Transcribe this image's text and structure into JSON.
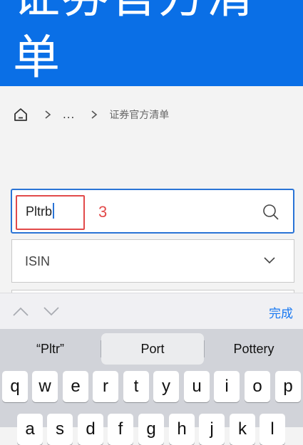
{
  "header": {
    "title": "证券官方清单",
    "visible_title": "单",
    "background": "#0a6fe6"
  },
  "breadcrumb": {
    "home_icon": "home-icon",
    "ellipsis": "...",
    "current": "证券官方清单"
  },
  "search": {
    "value": "Pltrb",
    "icon": "search-icon",
    "border_color": "#2a74d6"
  },
  "annotation": {
    "label": "3",
    "color": "#e24a4a"
  },
  "select": {
    "value": "ISIN",
    "icon": "chevron-down-icon"
  },
  "accessory": {
    "prev_icon": "chevron-up-icon",
    "next_icon": "chevron-down-icon",
    "done_label": "完成",
    "accent": "#1778f2"
  },
  "keyboard": {
    "suggestions": [
      "“Pltr”",
      "Port",
      "Pottery"
    ],
    "selected_suggestion": 1,
    "row1": [
      "q",
      "w",
      "e",
      "r",
      "t",
      "y",
      "u",
      "i",
      "o",
      "p"
    ],
    "row2": [
      "a",
      "s",
      "d",
      "f",
      "g",
      "h",
      "j",
      "k",
      "l"
    ]
  }
}
